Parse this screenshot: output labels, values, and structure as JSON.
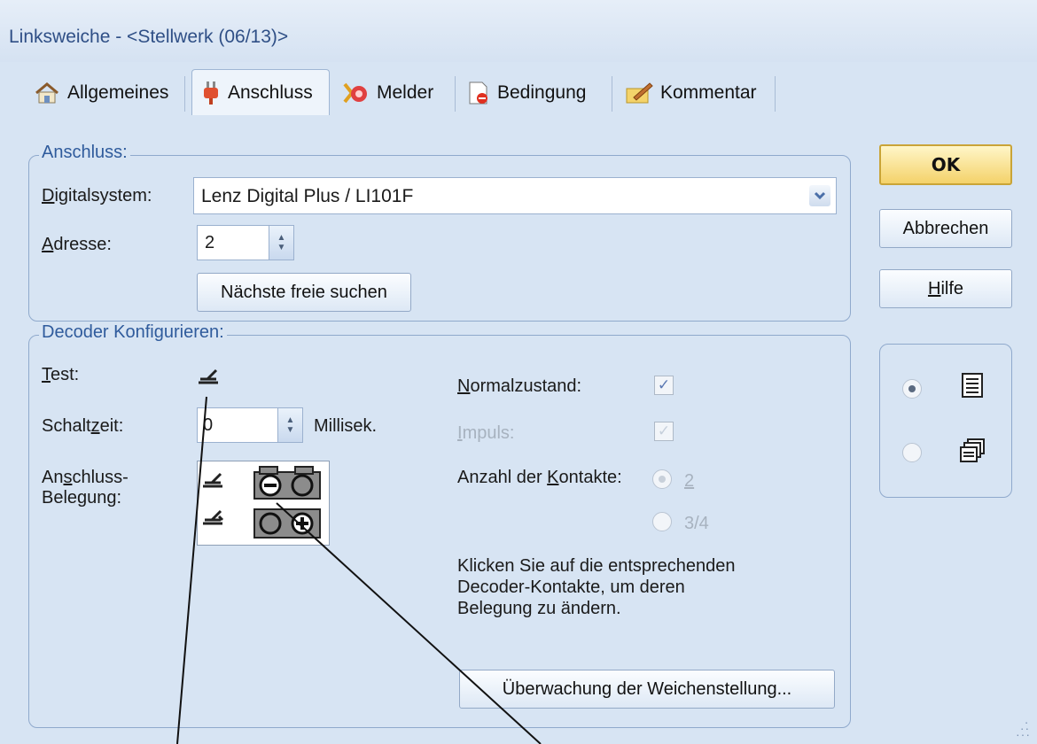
{
  "window": {
    "title": "Linksweiche - <Stellwerk (06/13)>"
  },
  "tabs": [
    {
      "label": "Allgemeines",
      "icon": "house-icon"
    },
    {
      "label": "Anschluss",
      "icon": "plug-icon"
    },
    {
      "label": "Melder",
      "icon": "sensor-icon"
    },
    {
      "label": "Bedingung",
      "icon": "condition-icon"
    },
    {
      "label": "Kommentar",
      "icon": "comment-icon"
    }
  ],
  "anschluss": {
    "legend": "Anschluss:",
    "digitalsystem_label": "Digitalsystem:",
    "digitalsystem_value": "Lenz Digital Plus / LI101F",
    "adresse_label": "Adresse:",
    "adresse_value": "2",
    "find_button": "Nächste freie suchen"
  },
  "decoder": {
    "legend": "Decoder Konfigurieren:",
    "test_label": "Test:",
    "schaltzeit_label": "Schaltzeit:",
    "schaltzeit_value": "0",
    "schaltzeit_unit": "Millisek.",
    "belegung_label_1": "Anschluss-",
    "belegung_label_2": "Belegung:",
    "normalzustand_label": "Normalzustand:",
    "normalzustand_checked": true,
    "impuls_label": "Impuls:",
    "impuls_checked": true,
    "kontakte_label": "Anzahl der Kontakte:",
    "kontakte_options": [
      "2",
      "3/4"
    ],
    "kontakte_selected": "2",
    "hint_lines": [
      "Klicken Sie auf die entsprechenden",
      "Decoder-Kontakte, um deren",
      "Belegung zu ändern."
    ],
    "monitor_button": "Überwachung der Weichenstellung..."
  },
  "buttons": {
    "ok": "OK",
    "cancel": "Abbrechen",
    "help": "Hilfe"
  },
  "view": {
    "selected": "list",
    "options": [
      "list-view-icon",
      "windows-view-icon"
    ]
  },
  "colors": {
    "accent": "#2f5b9c",
    "window_bg": "#d7e4f3",
    "ok_button": "#f4d26a"
  }
}
